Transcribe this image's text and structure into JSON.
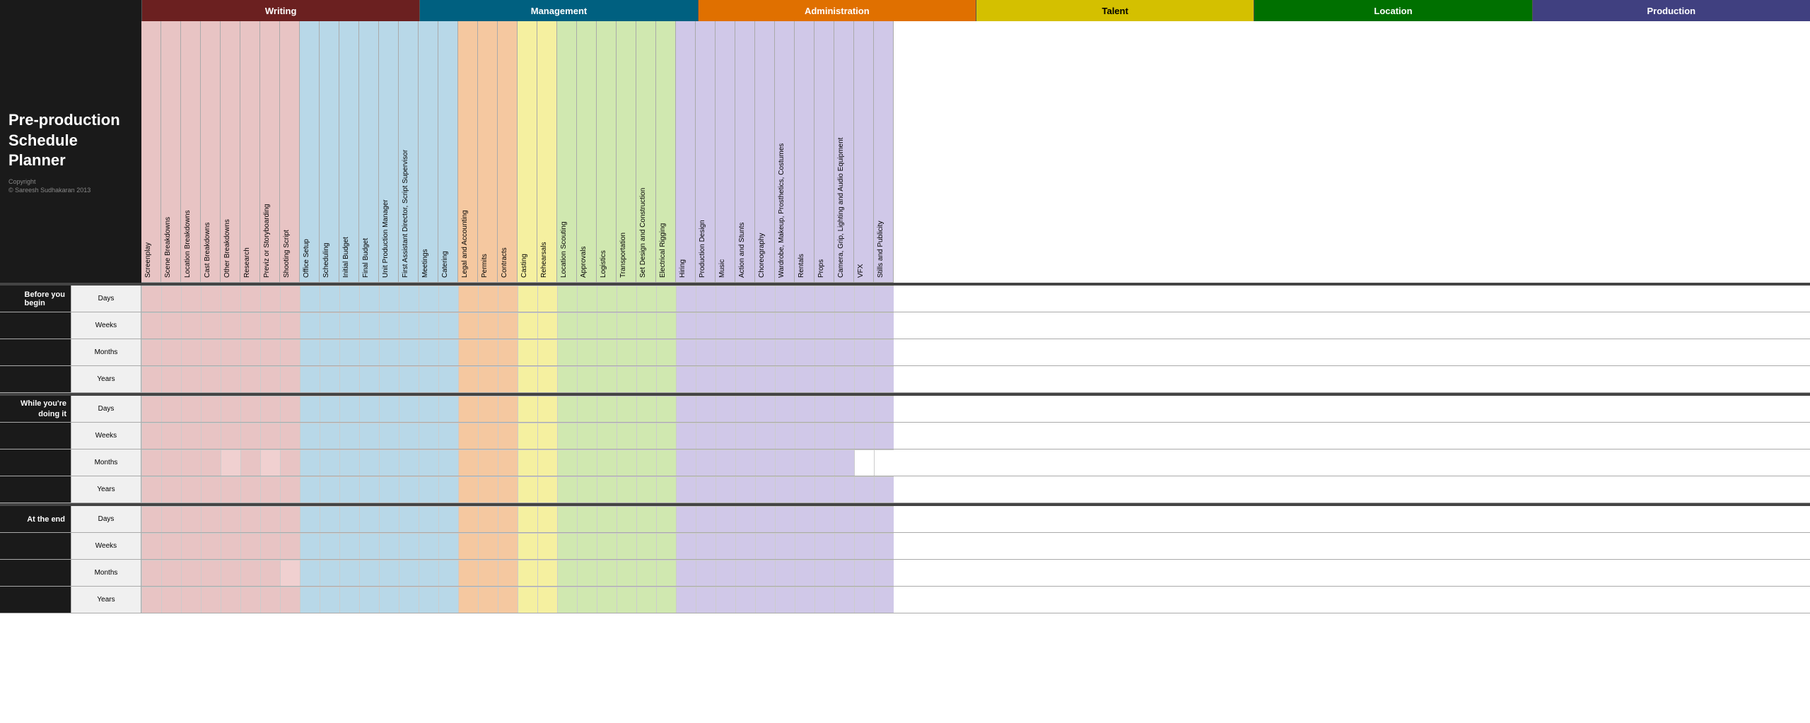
{
  "title": "Pre-production Schedule Planner",
  "copyright": "Copyright",
  "author": "© Sareesh   Sudhakaran 2013",
  "sections": {
    "writing": {
      "label": "Writing",
      "color": "#7b2020",
      "headerBg": "#7b2020",
      "columns": [
        "Screenplay",
        "Scene Breakdowns",
        "Location Breakdowns",
        "Cast Breakdowns",
        "Other Breakdowns",
        "Research",
        "Previz or Storyboarding",
        "Shooting Script"
      ]
    },
    "management": {
      "label": "Management",
      "color": "#006080",
      "columns": [
        "Office Setup",
        "Scheduling",
        "Initial Budget",
        "Final Budget",
        "Unit Production Manager",
        "First Assistant Director, Script Supervisor",
        "Meetings",
        "Catering"
      ]
    },
    "administration": {
      "label": "Administration",
      "color": "#e07000",
      "columns": [
        "Legal and Accounting",
        "Permits",
        "Contracts"
      ]
    },
    "talent": {
      "label": "Talent",
      "color": "#d4c000",
      "columns": [
        "Casting",
        "Rehearsals"
      ]
    },
    "location": {
      "label": "Location",
      "color": "#007000",
      "columns": [
        "Location Scouting",
        "Approvals",
        "Logistics",
        "Transportation",
        "Set Design and Construction",
        "Electrical Rigging"
      ]
    },
    "production": {
      "label": "Production",
      "color": "#404080",
      "columns": [
        "Hiring",
        "Production Design",
        "Music",
        "Action and Stunts",
        "Choreography",
        "Wardrobe, Makeup, Prosthetics, Costumes",
        "Rentals",
        "Props",
        "Camera, Grip, Lighting and Audio Equipment",
        "VFX",
        "Stills and Publicity"
      ]
    }
  },
  "rowGroups": [
    {
      "name": "Before you begin",
      "rows": [
        "Days",
        "Weeks",
        "Months",
        "Years"
      ]
    },
    {
      "name": "While you're doing it",
      "rows": [
        "Days",
        "Weeks",
        "Months",
        "Years"
      ]
    },
    {
      "name": "At the end",
      "rows": [
        "Days",
        "Weeks",
        "Months",
        "Years"
      ]
    }
  ]
}
